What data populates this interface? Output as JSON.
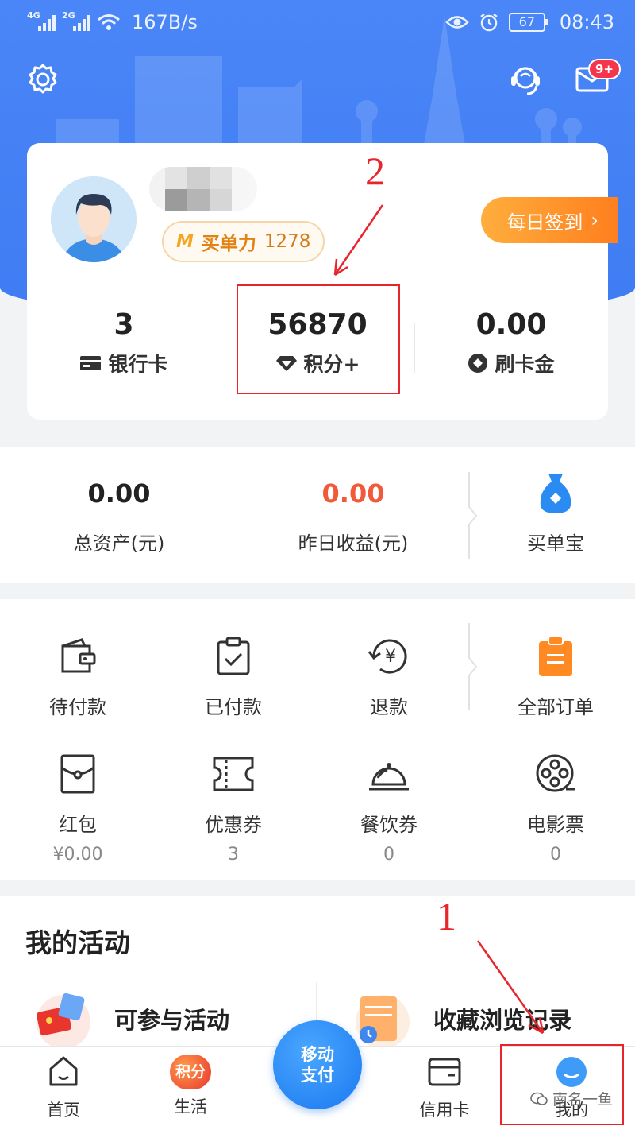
{
  "statusbar": {
    "net1": "4G",
    "net2": "2G",
    "speed": "167B/s",
    "battery": "67",
    "time": "08:43"
  },
  "header": {
    "message_badge": "9+"
  },
  "profile": {
    "buy_power_label": "买单力",
    "buy_power_value": "1278",
    "checkin_label": "每日签到",
    "stats": [
      {
        "value": "3",
        "label": "银行卡"
      },
      {
        "value": "56870",
        "label": "积分+"
      },
      {
        "value": "0.00",
        "label": "刷卡金"
      }
    ]
  },
  "assets": {
    "total_value": "0.00",
    "total_label": "总资产(元)",
    "yesterday_value": "0.00",
    "yesterday_label": "昨日收益(元)",
    "treasure_label": "买单宝"
  },
  "orders": {
    "row1": [
      {
        "label": "待付款",
        "icon": "wallet-icon"
      },
      {
        "label": "已付款",
        "icon": "clipboard-check-icon"
      },
      {
        "label": "退款",
        "icon": "refund-yen-icon"
      },
      {
        "label": "全部订单",
        "icon": "orders-icon"
      }
    ],
    "row2": [
      {
        "label": "红包",
        "sub": "¥0.00",
        "icon": "red-envelope-icon"
      },
      {
        "label": "优惠券",
        "sub": "3",
        "icon": "coupon-icon"
      },
      {
        "label": "餐饮券",
        "sub": "0",
        "icon": "dining-cloche-icon"
      },
      {
        "label": "电影票",
        "sub": "0",
        "icon": "film-reel-icon"
      }
    ]
  },
  "activities": {
    "title": "我的活动",
    "items": [
      {
        "label": "可参与活动"
      },
      {
        "label": "收藏浏览记录"
      }
    ]
  },
  "nav": {
    "home": "首页",
    "life": "生活",
    "life_badge": "积分",
    "pay_line1": "移动",
    "pay_line2": "支付",
    "credit": "信用卡",
    "mine": "我的"
  },
  "annotations": {
    "num1": "1",
    "num2": "2"
  },
  "watermark": "南名一鱼",
  "colors": {
    "brand_blue": "#3f7cf3",
    "orange": "#ff8a24",
    "red": "#f05a3a",
    "annotation_red": "#e8252c"
  }
}
